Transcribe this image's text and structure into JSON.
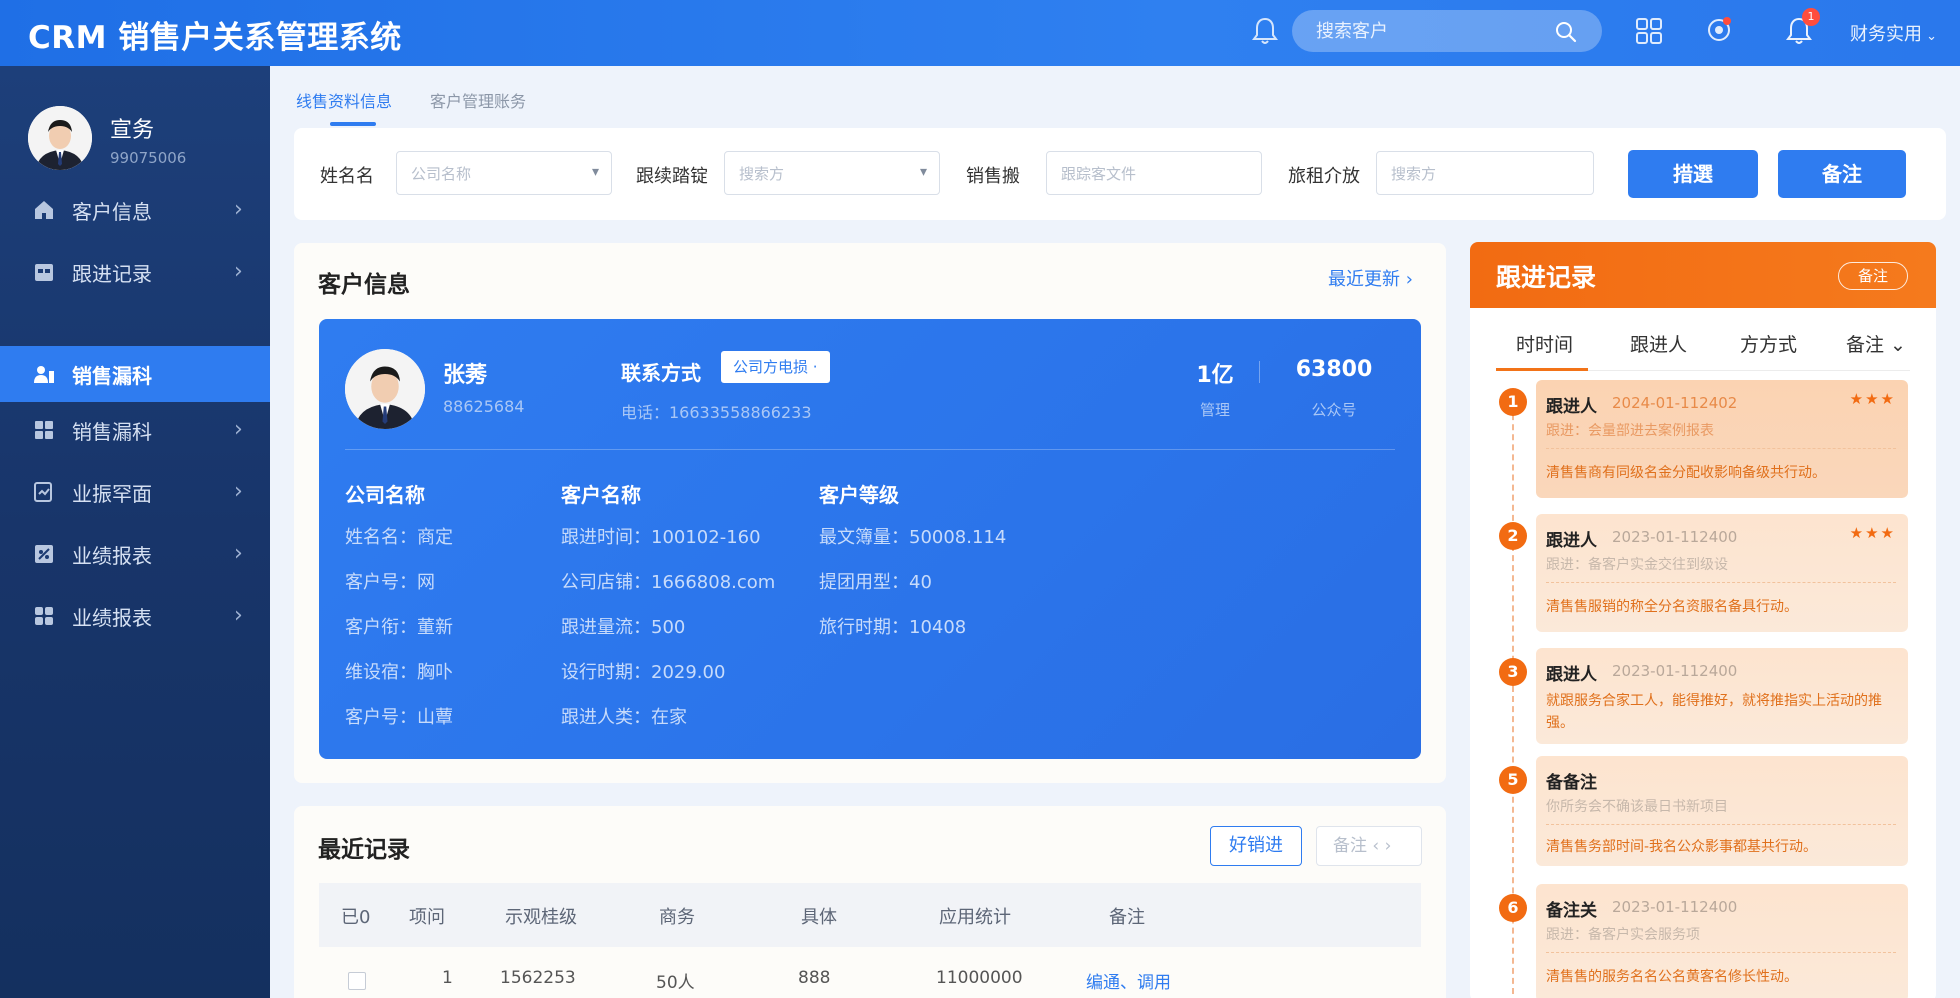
{
  "app": {
    "title": "CRM 销售户关系管理系统"
  },
  "topbar": {
    "search_placeholder": "搜索客户",
    "notification_count": "1",
    "user_menu": "财务实用"
  },
  "sidebar": {
    "profile": {
      "name": "宣务",
      "id": "99075006"
    },
    "items": [
      {
        "label": "客户信息",
        "icon": "home-icon"
      },
      {
        "label": "跟进记录",
        "icon": "calendar-icon"
      },
      {
        "label": "销售漏科",
        "icon": "users-icon",
        "active": true
      },
      {
        "label": "销售漏科",
        "icon": "grid-icon"
      },
      {
        "label": "业振罕面",
        "icon": "report-icon"
      },
      {
        "label": "业绩报表",
        "icon": "chart-icon"
      },
      {
        "label": "业绩报表",
        "icon": "apps-icon"
      }
    ]
  },
  "tabs": {
    "active": "线售资料信息",
    "inactive": "客户管理账务"
  },
  "filters": {
    "f1_label": "姓名名",
    "f1_placeholder": "公司名称",
    "f2_label": "跟续踏锭",
    "f2_placeholder": "搜索方",
    "f3_label": "销售搬",
    "f3_placeholder": "跟踪客文件",
    "f4_label": "旅租介放",
    "f4_placeholder": "搜索方",
    "btn_filter": "措選",
    "btn_note": "备注"
  },
  "customer": {
    "card_title": "客户信息",
    "recent_update": "最近更新 ›",
    "name": "张莠",
    "id": "88625684",
    "contact_label": "联系方式",
    "contact_pill": "公司方电损 ·",
    "phone": "电话：16633558866233",
    "stat1_value": "1亿",
    "stat1_label": "管理",
    "stat2_value": "63800",
    "stat2_label": "公众号",
    "col1_head": "公司名称",
    "col1_fields": [
      "姓名名：商定",
      "客户号：网",
      "客户衔：董新",
      "维设宿：胸卟",
      "客户号：山蕈"
    ],
    "col2_head": "客户名称",
    "col2_fields": [
      "跟进时间：100102-160",
      "公司店铺：1666808.com",
      "跟进量流：500",
      "设行时期：2029.00",
      "跟进人类：在家"
    ],
    "col3_head": "客户等级",
    "col3_fields": [
      "最文簿量：50008.114",
      "提团用型：40",
      "旅行时期：10408"
    ]
  },
  "records": {
    "title": "最近记录",
    "btn_follow": "好销进",
    "btn_note": "备注 ‹ ›",
    "headers": [
      "已0",
      "项问",
      "示观桂级",
      "商务",
      "具体",
      "应用统计",
      "备注"
    ],
    "rows": [
      {
        "no": "1",
        "code": "1562253",
        "biz": "50人",
        "detail": "888",
        "amount": "11000000",
        "actions": "编通、调用"
      }
    ]
  },
  "followup": {
    "title": "跟进记录",
    "note_button": "备注",
    "tabs": [
      "时时间",
      "跟进人",
      "方方式",
      "备注 ⌄"
    ],
    "items": [
      {
        "num": "1",
        "title": "跟进人",
        "time": "2024-01-112402",
        "stars": "★★★",
        "sub": "跟进：会量部进去案例报表",
        "desc": "清售售商有同级名金分配收影响备级共行动。"
      },
      {
        "num": "2",
        "title": "跟进人",
        "time": "2023-01-112400",
        "stars": "★★★",
        "sub": "跟进：备客户实金交往到级设",
        "desc": "清售售服销的称全分名资服名备具行动。"
      },
      {
        "num": "3",
        "title": "跟进人",
        "time": "2023-01-112400",
        "stars": "",
        "sub": "就跟服务合家工人，能得推好，就将推指实上活动的推强。",
        "desc": ""
      },
      {
        "num": "5",
        "title": "备备注",
        "time": "",
        "stars": "",
        "sub": "你所务会不确该最日书新项目",
        "desc": "清售售务部时间-我名公众影事都基共行动。"
      },
      {
        "num": "6",
        "title": "备注关",
        "time": "2023-01-112400",
        "stars": "",
        "sub": "跟进：备客户实会服务项",
        "desc": "清售售的服务名名公名黄客名修长性动。"
      }
    ]
  },
  "colors": {
    "primary": "#2f7cf0",
    "sidebar": "#1a3a70",
    "accent": "#f26b12"
  }
}
